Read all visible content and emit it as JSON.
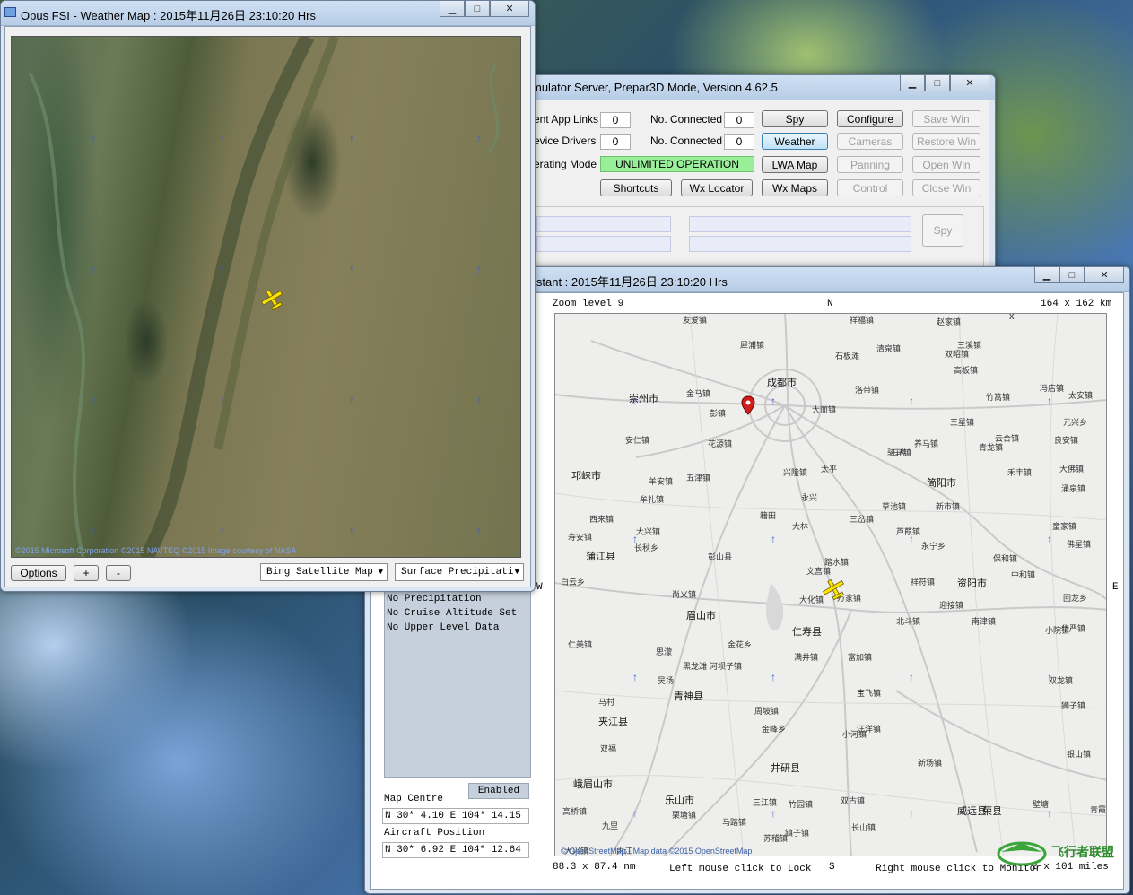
{
  "server": {
    "title": "mulator Server, Prepar3D Mode, Version 4.62.5",
    "rows": [
      {
        "label": "ent App Links",
        "value": "0",
        "label2": "No. Connected",
        "value2": "0"
      },
      {
        "label": "evice Drivers",
        "value": "0",
        "label2": "No. Connected",
        "value2": "0"
      }
    ],
    "op_mode_label": "erating Mode",
    "op_mode_value": "UNLIMITED OPERATION",
    "buttons": {
      "spy": "Spy",
      "configure": "Configure",
      "save_win": "Save Win",
      "weather": "Weather",
      "cameras": "Cameras",
      "restore_win": "Restore Win",
      "lwa_map": "LWA Map",
      "panning": "Panning",
      "open_win": "Open Win",
      "shortcuts": "Shortcuts",
      "wx_locator": "Wx Locator",
      "wx_maps": "Wx Maps",
      "control": "Control",
      "close_win": "Close Win",
      "spy2": "Spy"
    }
  },
  "weather_map": {
    "title": "Opus FSI - Weather Map : 2015年11月26日  23:10:20 Hrs",
    "copyright": "©2015 Microsoft Corporation ©2015 NAVTEQ ©2015 Image courtesy of NASA",
    "options_label": "Options",
    "zoom_in_label": "+",
    "zoom_out_label": "-",
    "map_type": "Bing Satellite Map",
    "layer": "Surface Precipitati",
    "dropdown_icon": "▼"
  },
  "assistant": {
    "title": "istant : 2015年11月26日  23:10:20 Hrs",
    "zoom_level": "Zoom level 9",
    "north": "N",
    "south": "S",
    "east": "E",
    "west": "W",
    "extent_km": "164 x 162 km",
    "extent_miles_left": "88.3 x 87.4 nm",
    "extent_miles_right": "2 x 101 miles",
    "left_hint": "Left mouse click to Lock",
    "right_hint": "Right mouse click to Monitor",
    "attribution": "© OpenStreetMap - Map data ©2015 OpenStreetMap",
    "info_lines": [
      "No Precipitation",
      "No Cruise Altitude Set",
      "No Upper Level Data"
    ],
    "enabled_label": "Enabled",
    "map_centre_label": "Map Centre",
    "map_centre_value": "N 30* 4.10  E 104* 14.15",
    "aircraft_position_label": "Aircraft Position",
    "aircraft_position_value": "N 30* 6.92  E 104* 12.64",
    "close_x": "x",
    "towns": [
      {
        "name": "成都市",
        "big": true
      },
      {
        "name": "友爱镇"
      },
      {
        "name": "祥福镇"
      },
      {
        "name": "赵家镇"
      },
      {
        "name": "三溪镇"
      },
      {
        "name": "犀浦镇"
      },
      {
        "name": "石板滩"
      },
      {
        "name": "清泉镇"
      },
      {
        "name": "双昭镇"
      },
      {
        "name": "高板镇"
      },
      {
        "name": "崇州市",
        "big": true
      },
      {
        "name": "金马镇"
      },
      {
        "name": "洛带镇"
      },
      {
        "name": "竹篙镇"
      },
      {
        "name": "冯店镇"
      },
      {
        "name": "太安镇"
      },
      {
        "name": "彭镇"
      },
      {
        "name": "大面镇"
      },
      {
        "name": "三星镇"
      },
      {
        "name": "元兴乡"
      },
      {
        "name": "安仁镇"
      },
      {
        "name": "花源镇"
      },
      {
        "name": "养马镇"
      },
      {
        "name": "青龙镇"
      },
      {
        "name": "云合镇"
      },
      {
        "name": "良安镇"
      },
      {
        "name": "骑马镇"
      },
      {
        "name": "石盘"
      },
      {
        "name": "邛崃市",
        "big": true
      },
      {
        "name": "五津镇"
      },
      {
        "name": "兴隆镇"
      },
      {
        "name": "太平"
      },
      {
        "name": "禾丰镇"
      },
      {
        "name": "大佛镇"
      },
      {
        "name": "羊安镇"
      },
      {
        "name": "简阳市",
        "big": true
      },
      {
        "name": "涌泉镇"
      },
      {
        "name": "牟礼镇"
      },
      {
        "name": "永兴"
      },
      {
        "name": "草池镇"
      },
      {
        "name": "新市镇"
      },
      {
        "name": "西来镇"
      },
      {
        "name": "籍田"
      },
      {
        "name": "三岔镇"
      },
      {
        "name": "寿安镇"
      },
      {
        "name": "大林"
      },
      {
        "name": "芦葭镇"
      },
      {
        "name": "童家镇"
      },
      {
        "name": "大兴镇"
      },
      {
        "name": "长秋乡"
      },
      {
        "name": "永宁乡"
      },
      {
        "name": "佛星镇"
      },
      {
        "name": "蒲江县",
        "big": true
      },
      {
        "name": "彭山县"
      },
      {
        "name": "踏水镇"
      },
      {
        "name": "保和镇"
      },
      {
        "name": "文宫镇"
      },
      {
        "name": "中和镇"
      },
      {
        "name": "白云乡"
      },
      {
        "name": "祥符镇"
      },
      {
        "name": "资阳市",
        "big": true
      },
      {
        "name": "尚义镇"
      },
      {
        "name": "大化镇"
      },
      {
        "name": "万家镇"
      },
      {
        "name": "回龙乡"
      },
      {
        "name": "迎接镇"
      },
      {
        "name": "眉山市",
        "big": true
      },
      {
        "name": "北斗镇"
      },
      {
        "name": "南津镇"
      },
      {
        "name": "仁寿县",
        "big": true
      },
      {
        "name": "小院镇"
      },
      {
        "name": "华严镇"
      },
      {
        "name": "仁美镇"
      },
      {
        "name": "金花乡"
      },
      {
        "name": "思濛"
      },
      {
        "name": "满井镇"
      },
      {
        "name": "富加镇"
      },
      {
        "name": "黑龙滩"
      },
      {
        "name": "河坝子镇"
      },
      {
        "name": "吴场"
      },
      {
        "name": "双龙镇"
      },
      {
        "name": "青神县",
        "big": true
      },
      {
        "name": "马村"
      },
      {
        "name": "宝飞镇"
      },
      {
        "name": "狮子镇"
      },
      {
        "name": "夹江县",
        "big": true
      },
      {
        "name": "周坡镇"
      },
      {
        "name": "金峰乡"
      },
      {
        "name": "汪洋镇"
      },
      {
        "name": "双福"
      },
      {
        "name": "小河镇"
      },
      {
        "name": "井研县",
        "big": true
      },
      {
        "name": "新场镇"
      },
      {
        "name": "银山镇"
      },
      {
        "name": "峨眉山市",
        "big": true
      },
      {
        "name": "乐山市",
        "big": true
      },
      {
        "name": "三江镇"
      },
      {
        "name": "竹园镇"
      },
      {
        "name": "双古镇"
      },
      {
        "name": "高桥镇"
      },
      {
        "name": "九里"
      },
      {
        "name": "马踏镇"
      },
      {
        "name": "长山镇"
      },
      {
        "name": "威远县",
        "big": true
      },
      {
        "name": "荣县",
        "big": true
      },
      {
        "name": "镇子镇"
      },
      {
        "name": "苏稽镇"
      },
      {
        "name": "栗塘镇"
      },
      {
        "name": "青霞镇"
      },
      {
        "name": "壁塘"
      },
      {
        "name": "大兴镇"
      },
      {
        "name": "内江"
      }
    ]
  }
}
